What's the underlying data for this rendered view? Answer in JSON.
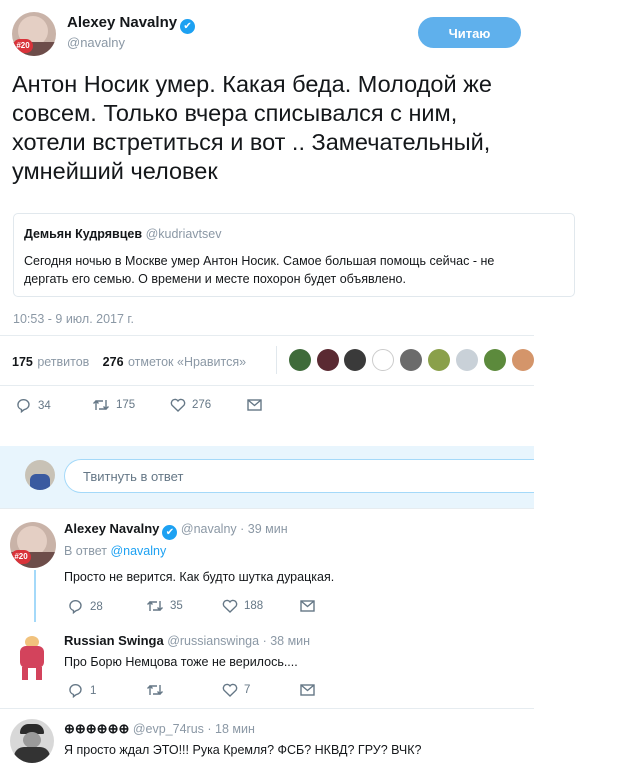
{
  "tweet": {
    "author_name": "Alexey Navalny",
    "author_handle": "@navalny",
    "verified_mark": "✔",
    "follow_label": "Читаю",
    "avatar_badge": "#20",
    "text": "Антон Носик умер. Какая беда. Молодой же совсем. Только вчера списывался с ним, хотели встретиться и вот .. Замечательный, умнейший человек",
    "quote": {
      "name": "Демьян Кудрявцев",
      "handle": "@kudriavtsev",
      "text": "Сегодня ночью в Москве умер Антон Носик. Самое большая помощь сейчас - не дергать его семью. О времени и месте похорон будет объявлено."
    },
    "timestamp": "10:53 - 9 июл. 2017 г.",
    "retweets_count": "175",
    "retweets_label": "ретвитов",
    "likes_count": "276",
    "likes_label": "отметок «Нравится»",
    "actions": {
      "replies": "34",
      "retweets": "175",
      "likes": "276"
    }
  },
  "reply_box": {
    "placeholder": "Твитнуть в ответ"
  },
  "replies": [
    {
      "name": "Alexey Navalny",
      "handle": "@navalny",
      "time": "· 39 мин",
      "reply_to_prefix": "В ответ",
      "reply_to_handle": "@navalny",
      "text": "Просто не верится. Как будто шутка дурацкая.",
      "replies": "28",
      "retweets": "35",
      "likes": "188"
    },
    {
      "name": "Russian Swinga",
      "handle": "@russianswinga",
      "time": "· 38 мин",
      "text": "Про Борю Немцова тоже не верилось....",
      "replies": "1",
      "retweets": "",
      "likes": "7"
    },
    {
      "name": "⊕⊕⊕⊕⊕⊕",
      "handle": "@evp_74rus",
      "time": "· 18 мин",
      "text": "Я просто ждал ЭТО!!! Рука Кремля? ФСБ? НКВД? ГРУ? ВЧК?"
    }
  ],
  "colors": {
    "accent": "#1da1f2",
    "follow_button": "#5fb0ec",
    "reply_bar": "#e8f5fd",
    "thread_line": "#a4d9f9"
  }
}
